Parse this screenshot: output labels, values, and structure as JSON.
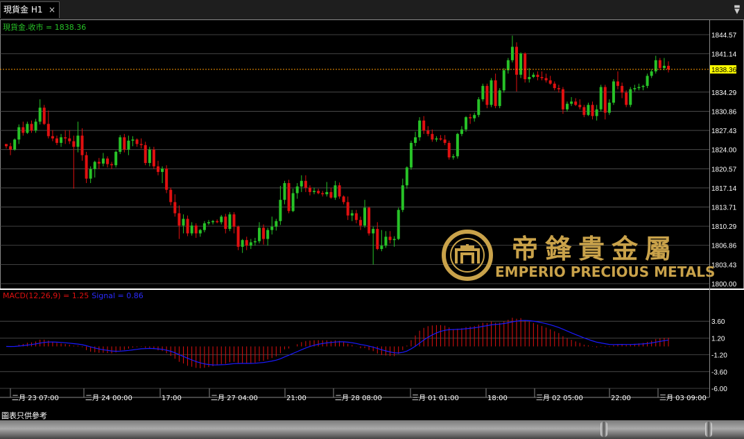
{
  "window": {
    "tab_label": "現貨金 H1",
    "close_glyph": "×",
    "menu_glyph": "▬"
  },
  "price_panel": {
    "legend": "現貨金.收市 = 1838.36",
    "y_ticks": [
      "1844.57",
      "1841.14",
      "1838.36",
      "1834.29",
      "1830.86",
      "1827.43",
      "1824.00",
      "1820.57",
      "1817.14",
      "1813.71",
      "1810.29",
      "1806.86",
      "1803.43",
      "1800.00"
    ],
    "current_price_label": "1838.36",
    "current_price": 1838.36,
    "up_color": "#27c227",
    "down_color": "#e01010",
    "current_line_color": "#ff9a00",
    "current_label_bg": "#ffff00"
  },
  "macd_panel": {
    "legend_main": "MACD(12,26,9) = 1.25",
    "legend_signal": "Signal = 0.86",
    "y_ticks": [
      "3.60",
      "1.20",
      "-1.20",
      "-3.60",
      "-6.00"
    ],
    "histogram_color": "#e01010",
    "signal_color": "#1a1aff"
  },
  "x_axis": {
    "labels": [
      "二月 23 07:00",
      "二月 24 00:00",
      "17:00",
      "二月 27 04:00",
      "21:00",
      "二月 28 08:00",
      "三月 01 01:00",
      "18:00",
      "三月 02 05:00",
      "22:00",
      "三月 03 09:00"
    ]
  },
  "watermark": {
    "chinese": "帝鋒貴金屬",
    "english": "EMPERIO PRECIOUS METALS",
    "color": "#c9a24a"
  },
  "footer": {
    "note": "圖表只供參考"
  },
  "chart_data": {
    "type": "candlestick",
    "symbol": "現貨金",
    "timeframe": "H1",
    "close": 1838.36,
    "ylim": [
      1800.0,
      1844.57
    ],
    "macd": 1.25,
    "signal": 0.86,
    "macd_ylim": [
      -6.0,
      3.6
    ],
    "candles": [
      [
        1825,
        1825,
        1824.2,
        1824.6
      ],
      [
        1824.6,
        1825.2,
        1823,
        1824
      ],
      [
        1824,
        1826,
        1823.8,
        1825.8
      ],
      [
        1825.8,
        1828.5,
        1825,
        1828
      ],
      [
        1828,
        1829,
        1826.5,
        1827
      ],
      [
        1827,
        1829,
        1826.8,
        1828.6
      ],
      [
        1828.6,
        1829.2,
        1827,
        1827.4
      ],
      [
        1827.4,
        1829.5,
        1827,
        1829
      ],
      [
        1829,
        1833,
        1828.5,
        1831.5
      ],
      [
        1831.5,
        1832,
        1828.4,
        1828.6
      ],
      [
        1828.6,
        1831,
        1826,
        1826.4
      ],
      [
        1826.4,
        1827.5,
        1825.5,
        1826
      ],
      [
        1826,
        1826.5,
        1824.8,
        1825.2
      ],
      [
        1825.2,
        1826.8,
        1824.5,
        1826.2
      ],
      [
        1826.2,
        1827.5,
        1825,
        1826
      ],
      [
        1826,
        1827.5,
        1825,
        1825.5
      ],
      [
        1825.5,
        1826.5,
        1817,
        1824.5
      ],
      [
        1824.5,
        1829,
        1823.5,
        1826.5
      ],
      [
        1826.5,
        1827.8,
        1822,
        1823
      ],
      [
        1823,
        1823.6,
        1818,
        1818.8
      ],
      [
        1818.8,
        1821,
        1818,
        1820.5
      ],
      [
        1820.5,
        1822,
        1819,
        1821.8
      ],
      [
        1821.8,
        1822.5,
        1820.5,
        1821.5
      ],
      [
        1821.5,
        1823.4,
        1821,
        1822.4
      ],
      [
        1822.4,
        1822.8,
        1820.8,
        1821.4
      ],
      [
        1821.4,
        1821.8,
        1820.5,
        1821.2
      ],
      [
        1821.2,
        1823.8,
        1820.8,
        1823.6
      ],
      [
        1823.6,
        1826.6,
        1823.2,
        1826.2
      ],
      [
        1826.2,
        1826.8,
        1823.5,
        1824
      ],
      [
        1824,
        1826.5,
        1823,
        1825.6
      ],
      [
        1825.6,
        1826.4,
        1824.6,
        1825.8
      ],
      [
        1825.8,
        1826,
        1824.5,
        1825
      ],
      [
        1825,
        1826,
        1824.2,
        1824.8
      ],
      [
        1824.8,
        1825.4,
        1821.2,
        1821.6
      ],
      [
        1821.6,
        1824.5,
        1821,
        1824
      ],
      [
        1824,
        1824.5,
        1820.5,
        1821
      ],
      [
        1821,
        1822,
        1819.4,
        1820
      ],
      [
        1820,
        1821,
        1818,
        1820.6
      ],
      [
        1820.6,
        1821.2,
        1816.2,
        1816.8
      ],
      [
        1816.8,
        1817.2,
        1814,
        1814.6
      ],
      [
        1814.6,
        1816,
        1812,
        1812.6
      ],
      [
        1812.6,
        1814,
        1808,
        1810.4
      ],
      [
        1810.4,
        1812.4,
        1809,
        1811.6
      ],
      [
        1811.6,
        1812.2,
        1808.5,
        1809
      ],
      [
        1809,
        1811,
        1808.6,
        1810.4
      ],
      [
        1810.4,
        1810.8,
        1808.2,
        1809
      ],
      [
        1809,
        1809.8,
        1808.4,
        1809.6
      ],
      [
        1809.6,
        1811.2,
        1809.2,
        1810.8
      ],
      [
        1810.8,
        1811.4,
        1810.5,
        1811
      ],
      [
        1811,
        1811.4,
        1810.6,
        1811.2
      ],
      [
        1811.2,
        1811.5,
        1810.8,
        1811
      ],
      [
        1811,
        1812.3,
        1810.6,
        1812
      ],
      [
        1812,
        1812.5,
        1809,
        1809.8
      ],
      [
        1809.8,
        1812.8,
        1809.4,
        1812.4
      ],
      [
        1812.4,
        1812.8,
        1809,
        1810.2
      ],
      [
        1810.2,
        1810.4,
        1806,
        1806.6
      ],
      [
        1806.6,
        1808,
        1805.5,
        1807.8
      ],
      [
        1807.8,
        1808.4,
        1806,
        1806.8
      ],
      [
        1806.8,
        1808,
        1806.2,
        1807.4
      ],
      [
        1807.4,
        1808.2,
        1806.8,
        1807.6
      ],
      [
        1807.6,
        1811,
        1807.2,
        1810
      ],
      [
        1810,
        1810.6,
        1807,
        1808
      ],
      [
        1808,
        1810,
        1806.8,
        1809.6
      ],
      [
        1809.6,
        1812,
        1808.8,
        1810.2
      ],
      [
        1810.2,
        1811.6,
        1809.5,
        1811.2
      ],
      [
        1811.2,
        1817.5,
        1810.5,
        1815
      ],
      [
        1815,
        1818.4,
        1814.2,
        1818
      ],
      [
        1818,
        1818.6,
        1812.6,
        1813
      ],
      [
        1813,
        1817,
        1812.8,
        1816.2
      ],
      [
        1816.2,
        1818,
        1815.2,
        1817.4
      ],
      [
        1817.4,
        1819.4,
        1816.4,
        1818.4
      ],
      [
        1818.4,
        1819.4,
        1816.4,
        1817.2
      ],
      [
        1817.2,
        1817.6,
        1815.8,
        1816.4
      ],
      [
        1816.4,
        1817.2,
        1816,
        1816.6
      ],
      [
        1816.6,
        1817,
        1816,
        1816.2
      ],
      [
        1816.2,
        1816.6,
        1815.6,
        1816
      ],
      [
        1816,
        1818.2,
        1815.6,
        1816.4
      ],
      [
        1816.4,
        1817.2,
        1815.2,
        1815.4
      ],
      [
        1815.4,
        1818.4,
        1815,
        1817.6
      ],
      [
        1817.6,
        1818.1,
        1815.2,
        1815.6
      ],
      [
        1815.6,
        1815.8,
        1814.2,
        1814.6
      ],
      [
        1814.6,
        1815.6,
        1811.4,
        1812.2
      ],
      [
        1812.2,
        1813.2,
        1811.2,
        1812.6
      ],
      [
        1812.6,
        1813.2,
        1810.8,
        1811.4
      ],
      [
        1811.4,
        1812,
        1809.6,
        1810.4
      ],
      [
        1810.4,
        1815,
        1810,
        1813.6
      ],
      [
        1813.6,
        1813.8,
        1808.6,
        1809
      ],
      [
        1809,
        1810.2,
        1803.4,
        1809.8
      ],
      [
        1809.8,
        1811,
        1806,
        1806.2
      ],
      [
        1806.2,
        1809.6,
        1805.8,
        1806.8
      ],
      [
        1806.8,
        1809.4,
        1806.4,
        1808.4
      ],
      [
        1808.4,
        1809.4,
        1807.2,
        1807.8
      ],
      [
        1807.8,
        1808.5,
        1806.6,
        1808
      ],
      [
        1808,
        1813.6,
        1807.8,
        1813.2
      ],
      [
        1813.2,
        1818.8,
        1812.8,
        1817.6
      ],
      [
        1817.6,
        1821,
        1817,
        1820.8
      ],
      [
        1820.8,
        1825.6,
        1820.4,
        1825.2
      ],
      [
        1825.2,
        1827.2,
        1824.6,
        1826.2
      ],
      [
        1826.2,
        1829.8,
        1825.6,
        1829.2
      ],
      [
        1829.2,
        1830,
        1826.8,
        1827.4
      ],
      [
        1827.4,
        1828.2,
        1826.4,
        1826.8
      ],
      [
        1826.8,
        1827.6,
        1825.4,
        1825.8
      ],
      [
        1825.8,
        1826.4,
        1825.4,
        1826
      ],
      [
        1826,
        1826.6,
        1825.6,
        1825.8
      ],
      [
        1825.8,
        1826.6,
        1824.8,
        1825.2
      ],
      [
        1825.2,
        1825.6,
        1822.2,
        1822.6
      ],
      [
        1822.6,
        1823.2,
        1822.2,
        1822.8
      ],
      [
        1822.8,
        1827,
        1822.4,
        1826.8
      ],
      [
        1826.8,
        1828.2,
        1826.4,
        1827.6
      ],
      [
        1827.6,
        1830,
        1827.2,
        1829.8
      ],
      [
        1829.8,
        1830.4,
        1828.6,
        1829.6
      ],
      [
        1829.6,
        1830.6,
        1829,
        1830.2
      ],
      [
        1830.2,
        1833.4,
        1829.8,
        1833
      ],
      [
        1833,
        1835.8,
        1832.6,
        1835.4
      ],
      [
        1835.4,
        1835.8,
        1831.4,
        1832
      ],
      [
        1832,
        1836.8,
        1831.6,
        1836.4
      ],
      [
        1836.4,
        1837.6,
        1831.4,
        1831.8
      ],
      [
        1831.8,
        1835,
        1831.4,
        1834.6
      ],
      [
        1834.6,
        1838.6,
        1834.2,
        1838.2
      ],
      [
        1838.2,
        1840.4,
        1837.6,
        1840
      ],
      [
        1840,
        1844.4,
        1839.6,
        1842.4
      ],
      [
        1842.4,
        1843.2,
        1834.4,
        1837.4
      ],
      [
        1837.4,
        1841.4,
        1836.8,
        1841.2
      ],
      [
        1841.2,
        1841.4,
        1836,
        1836.6
      ],
      [
        1836.6,
        1838.6,
        1836,
        1837
      ],
      [
        1837,
        1837.8,
        1836.8,
        1837.4
      ],
      [
        1837.4,
        1838,
        1836.4,
        1837
      ],
      [
        1837,
        1838,
        1836.4,
        1836.8
      ],
      [
        1836.8,
        1837.6,
        1836,
        1836.4
      ],
      [
        1836.4,
        1837.2,
        1835.6,
        1835.8
      ],
      [
        1835.8,
        1836.2,
        1834.6,
        1835
      ],
      [
        1835,
        1835.6,
        1834.2,
        1834.8
      ],
      [
        1834.8,
        1835.2,
        1830.4,
        1831.2
      ],
      [
        1831.2,
        1832.6,
        1830.8,
        1832.2
      ],
      [
        1832.2,
        1833.4,
        1831.8,
        1832.6
      ],
      [
        1832.6,
        1833.2,
        1831.8,
        1832
      ],
      [
        1832,
        1833,
        1831.2,
        1831.6
      ],
      [
        1831.6,
        1832,
        1829.8,
        1830.2
      ],
      [
        1830.2,
        1832.4,
        1830,
        1832
      ],
      [
        1832,
        1832.6,
        1829.4,
        1830
      ],
      [
        1830,
        1832,
        1829.2,
        1831.2
      ],
      [
        1831.2,
        1835.6,
        1830.8,
        1835.2
      ],
      [
        1835.2,
        1835.6,
        1829.4,
        1830.6
      ],
      [
        1830.6,
        1833,
        1830.2,
        1832.4
      ],
      [
        1832.4,
        1836.6,
        1832,
        1836.2
      ],
      [
        1836.2,
        1838,
        1834.8,
        1835.4
      ],
      [
        1835.4,
        1836,
        1833.2,
        1834.2
      ],
      [
        1834.2,
        1834.6,
        1831.6,
        1832
      ],
      [
        1832,
        1835.2,
        1831.6,
        1834.8
      ],
      [
        1834.8,
        1835.6,
        1834.4,
        1835
      ],
      [
        1835,
        1835.8,
        1834.6,
        1835.2
      ],
      [
        1835.2,
        1835.6,
        1834.6,
        1835.4
      ],
      [
        1835.4,
        1837.6,
        1835,
        1837.2
      ],
      [
        1837.2,
        1838.4,
        1836.8,
        1838
      ],
      [
        1838,
        1840.8,
        1837.6,
        1840
      ],
      [
        1840,
        1840.4,
        1838.2,
        1838.6
      ],
      [
        1838.6,
        1840.4,
        1838.2,
        1839
      ],
      [
        1839,
        1839.8,
        1837.8,
        1838.36
      ]
    ]
  }
}
